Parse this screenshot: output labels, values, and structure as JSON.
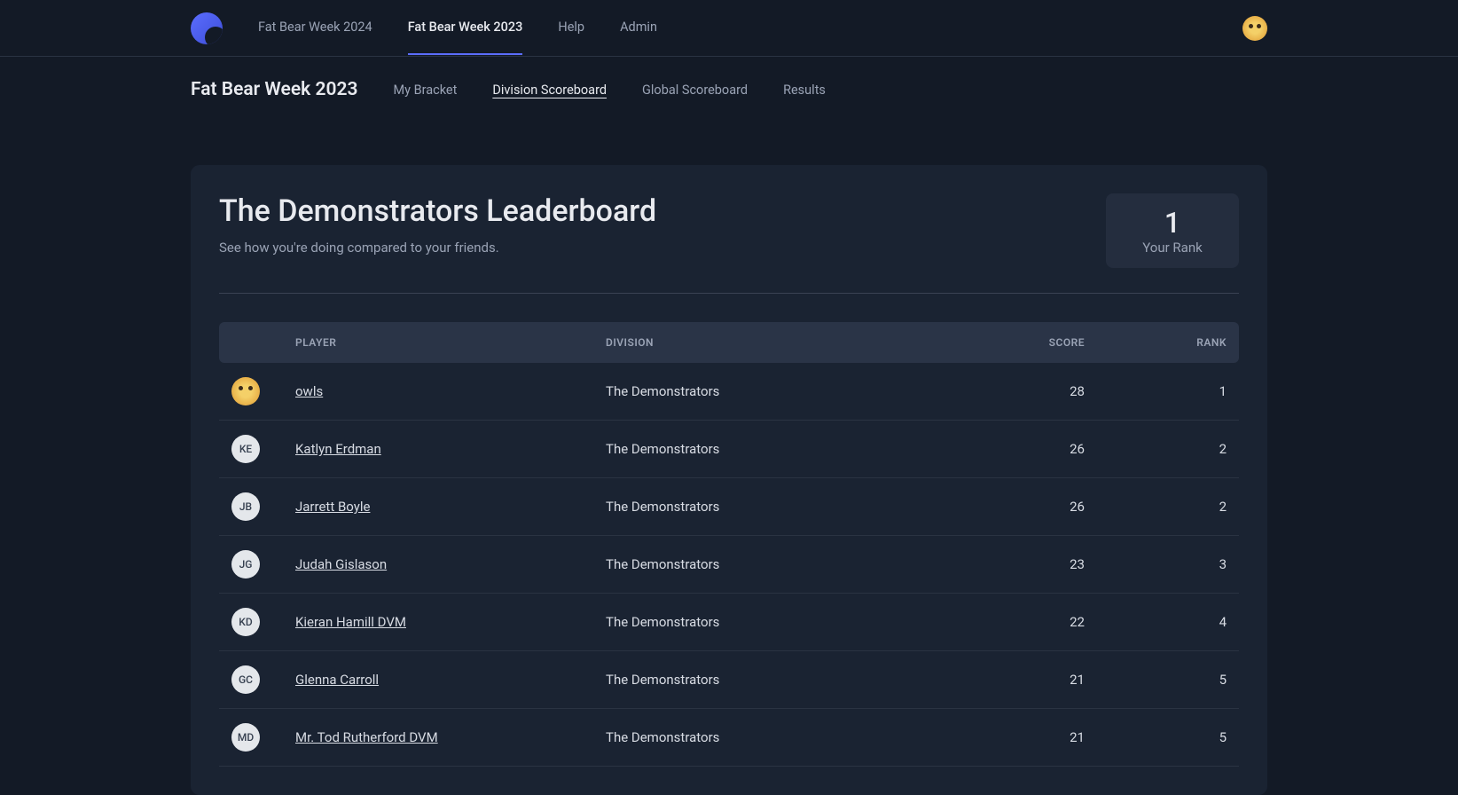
{
  "top_nav": {
    "links": [
      {
        "label": "Fat Bear Week 2024",
        "active": false
      },
      {
        "label": "Fat Bear Week 2023",
        "active": true
      },
      {
        "label": "Help",
        "active": false
      },
      {
        "label": "Admin",
        "active": false
      }
    ]
  },
  "sub_nav": {
    "title": "Fat Bear Week 2023",
    "links": [
      {
        "label": "My Bracket",
        "active": false
      },
      {
        "label": "Division Scoreboard",
        "active": true
      },
      {
        "label": "Global Scoreboard",
        "active": false
      },
      {
        "label": "Results",
        "active": false
      }
    ]
  },
  "leaderboard": {
    "title": "The Demonstrators Leaderboard",
    "subtitle": "See how you're doing compared to your friends.",
    "your_rank_value": "1",
    "your_rank_label": "Your Rank",
    "columns": {
      "player": "PLAYER",
      "division": "DIVISION",
      "score": "SCORE",
      "rank": "RANK"
    },
    "rows": [
      {
        "initials": "",
        "owl": true,
        "name": "owls",
        "division": "The Demonstrators",
        "score": "28",
        "rank": "1"
      },
      {
        "initials": "KE",
        "owl": false,
        "name": "Katlyn Erdman",
        "division": "The Demonstrators",
        "score": "26",
        "rank": "2"
      },
      {
        "initials": "JB",
        "owl": false,
        "name": "Jarrett Boyle",
        "division": "The Demonstrators",
        "score": "26",
        "rank": "2"
      },
      {
        "initials": "JG",
        "owl": false,
        "name": "Judah Gislason",
        "division": "The Demonstrators",
        "score": "23",
        "rank": "3"
      },
      {
        "initials": "KD",
        "owl": false,
        "name": "Kieran Hamill DVM",
        "division": "The Demonstrators",
        "score": "22",
        "rank": "4"
      },
      {
        "initials": "GC",
        "owl": false,
        "name": "Glenna Carroll",
        "division": "The Demonstrators",
        "score": "21",
        "rank": "5"
      },
      {
        "initials": "MD",
        "owl": false,
        "name": "Mr. Tod Rutherford DVM",
        "division": "The Demonstrators",
        "score": "21",
        "rank": "5"
      }
    ]
  }
}
